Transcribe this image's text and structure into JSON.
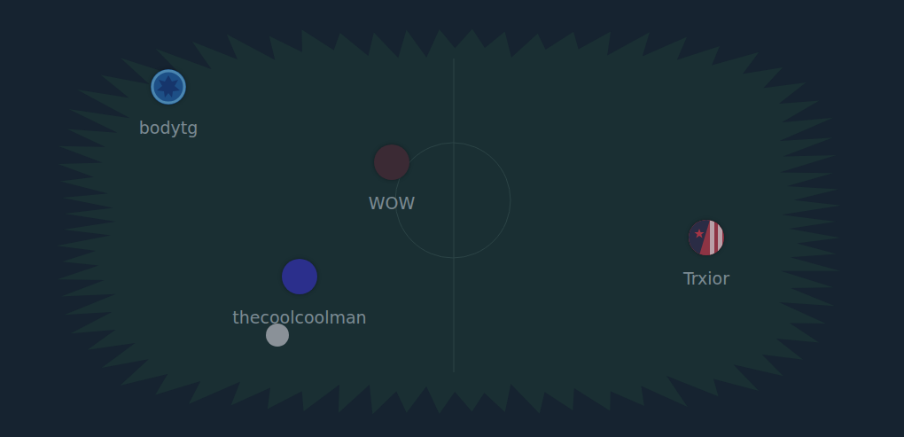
{
  "players": [
    {
      "name": "bodytg",
      "kind": "emblem",
      "color": "#1d4f86"
    },
    {
      "name": "WOW",
      "kind": "dot",
      "color": "#3b2a34"
    },
    {
      "name": "thecoolcoolman",
      "kind": "dot",
      "color": "#2b2f8c"
    },
    {
      "name": "Trxior",
      "kind": "flag",
      "color": "#7a2a3a"
    }
  ]
}
